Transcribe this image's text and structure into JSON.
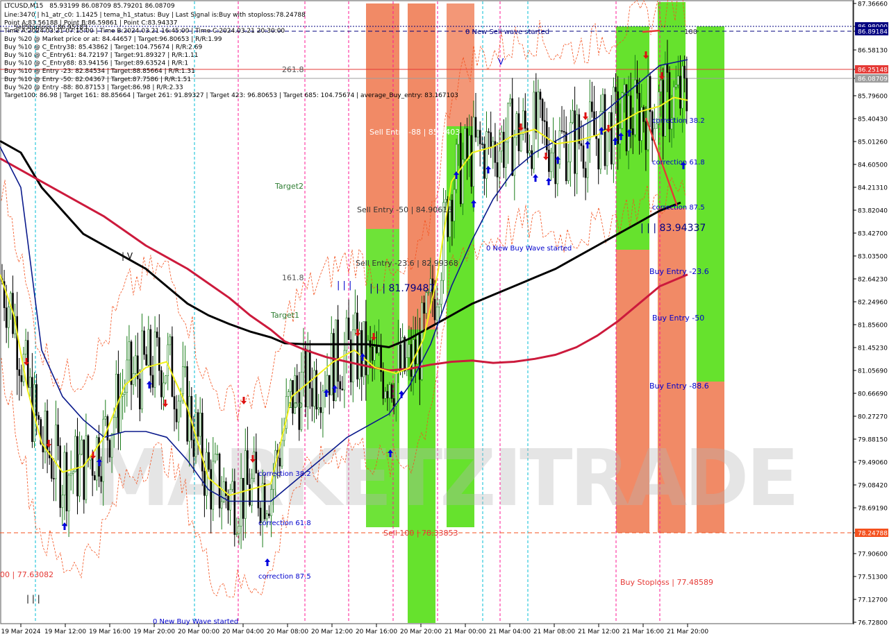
{
  "chart_data": {
    "type": "candlestick",
    "symbol_timeframe": "LTCUSD,M15",
    "header_ohlc": "85.93199 86.08709 85.79201 86.08709",
    "info_lines": [
      "Line:3470 | h1_atr_c0: 1.1425 | tema_h1_status: Buy | Last Signal is:Buy with stoploss:78.24788",
      "Point A:83.56188 | Point B:86.59861 | Point C:83.94337",
      "Time A:2024.03.21 07:15:00 | Time B:2024.03.21 16:45:00 | Time C:2024.03.21 20:30:00",
      "Buy %20 @ Market price or at: 84.44657 | Target:96.80653 | R/R:1.99",
      "Buy %10 @ C_Entry38: 85.43862 | Target:104.75674 | R/R:2.69",
      "Buy %10 @ C_Entry61: 84.72197 | Target:91.89327 | R/R:1.11",
      "Buy %10 @ C_Entry88: 83.94156 | Target:89.63524 | R/R:1",
      "Buy %10 @ Entry -23: 82.84534 | Target:88.85664 | R/R:1.31",
      "Buy %10 @ Entry -50: 82.04367 | Target:87.7586 | R/R:1.51",
      "Buy %20 @ Entry -88: 80.87153 | Target:86.98 | R/R:2.33",
      "Target100: 86.98 | Target 161: 88.85664 | Target 261: 91.89327 | Target 423: 96.80653 | Target 685: 104.75674 | average_Buy_entry: 83.167103"
    ],
    "y_ticks": [
      "87.36660",
      "86.98000",
      "86.89184",
      "86.58130",
      "86.25148",
      "86.08709",
      "85.79600",
      "85.40430",
      "85.01260",
      "84.60500",
      "84.21310",
      "83.82040",
      "83.42700",
      "83.03500",
      "82.64230",
      "82.24960",
      "81.85600",
      "81.45230",
      "81.05690",
      "80.66690",
      "80.27270",
      "79.88150",
      "79.49060",
      "79.08420",
      "78.69190",
      "78.24788",
      "77.90600",
      "77.51300",
      "77.12700",
      "76.72800"
    ],
    "x_ticks": [
      "19 Mar 2024",
      "19 Mar 12:00",
      "19 Mar 16:00",
      "19 Mar 20:00",
      "20 Mar 00:00",
      "20 Mar 04:00",
      "20 Mar 08:00",
      "20 Mar 12:00",
      "20 Mar 16:00",
      "20 Mar 20:00",
      "21 Mar 00:00",
      "21 Mar 04:00",
      "21 Mar 08:00",
      "21 Mar 12:00",
      "21 Mar 16:00",
      "21 Mar 20:00"
    ],
    "ylim": [
      76.728,
      87.3666
    ],
    "price_lines": [
      {
        "value": 86.98,
        "label": "86.98000",
        "color": "#000080"
      },
      {
        "value": 86.89184,
        "label": "86.89184",
        "color": "#000080"
      },
      {
        "value": 86.25148,
        "label": "86.25148",
        "color": "#e53935"
      },
      {
        "value": 86.08709,
        "label": "86.08709",
        "color": "#9e9e9e"
      },
      {
        "value": 78.24788,
        "label": "78.24788",
        "color": "#f4511e"
      }
    ],
    "annotations": [
      {
        "text": "0 New Sell wave started",
        "color": "#000080"
      },
      {
        "text": "100",
        "color": "#333333"
      },
      {
        "text": "261.8",
        "color": "#555555"
      },
      {
        "text": "Target2",
        "color": "#2e7d32"
      },
      {
        "text": "161.8",
        "color": "#555555"
      },
      {
        "text": "Target1",
        "color": "#2e7d32"
      },
      {
        "text": "100",
        "color": "#2e7d32"
      },
      {
        "text": "Sell Entry -88 | 85.2403",
        "color": "#ffffff"
      },
      {
        "text": "Sell Entry -50 | 84.90615",
        "color": "#333333"
      },
      {
        "text": "Sell Entry -23.6 | 82.99368",
        "color": "#333333"
      },
      {
        "text": "| | | 81.79487",
        "color": "#000080"
      },
      {
        "text": "| | |",
        "color": "#0000cc"
      },
      {
        "text": "0 New Buy Wave started",
        "color": "#0000cc"
      },
      {
        "text": "correction 38.2",
        "color": "#0000cc"
      },
      {
        "text": "correction 61.8",
        "color": "#0000cc"
      },
      {
        "text": "correction 87.5",
        "color": "#0000cc"
      },
      {
        "text": "| | | 83.94337",
        "color": "#000080"
      },
      {
        "text": "Buy Entry -23.6",
        "color": "#0000cc"
      },
      {
        "text": "Buy Entry -50",
        "color": "#0000cc"
      },
      {
        "text": "Buy Entry -88.6",
        "color": "#0000cc"
      },
      {
        "text": "correction 38.2",
        "color": "#0000cc"
      },
      {
        "text": "correction 61.8",
        "color": "#0000cc"
      },
      {
        "text": "correction 87.5",
        "color": "#0000cc"
      },
      {
        "text": "Sell 100 | 78.33853",
        "color": "#e53935"
      },
      {
        "text": "Buy Stoploss | 77.48589",
        "color": "#e53935"
      },
      {
        "text": "0 New Buy Wave started",
        "color": "#0000cc"
      },
      {
        "text": "00 | 77.63082",
        "color": "#e53935"
      },
      {
        "text": "| | |",
        "color": "#000000"
      },
      {
        "text": "| V",
        "color": "#000000"
      },
      {
        "text": "V",
        "color": "#0000cc"
      },
      {
        "text": "SellStoploss | 86.95183",
        "color": "#000000"
      }
    ],
    "watermark": "MARKETZITRADE",
    "colors": {
      "background": "#ffffff",
      "plot_bg": "#ffffff",
      "green_zone": "#5ee022",
      "red_zone": "#f07d55",
      "ma_black": "#000000",
      "ma_red": "#cc1a3c",
      "ma_blue": "#0a1a8c",
      "ma_yellow": "#f2f21a",
      "band_orange": "#f4511e",
      "bull_candle": "#1a7d1a",
      "bear_candle": "#000000"
    },
    "series": [
      {
        "name": "black_ma",
        "x": [
          0,
          30,
          60,
          90,
          120,
          150,
          180,
          210,
          240,
          270,
          300,
          330,
          360,
          390,
          410,
          440,
          470,
          500,
          530,
          560,
          590,
          620,
          650,
          680,
          710,
          740,
          770,
          800,
          830,
          860,
          890,
          920,
          950,
          980
        ],
        "values": [
          85.0,
          84.8,
          84.2,
          83.8,
          83.4,
          83.2,
          83.0,
          82.8,
          82.5,
          82.2,
          82.0,
          81.85,
          81.72,
          81.62,
          81.52,
          81.5,
          81.5,
          81.5,
          81.5,
          81.45,
          81.6,
          81.8,
          82.0,
          82.2,
          82.35,
          82.5,
          82.65,
          82.8,
          83.0,
          83.2,
          83.4,
          83.6,
          83.8,
          83.94
        ]
      },
      {
        "name": "red_ma",
        "x": [
          0,
          30,
          60,
          90,
          120,
          150,
          180,
          210,
          240,
          270,
          300,
          330,
          360,
          390,
          410,
          440,
          470,
          500,
          530,
          560,
          590,
          620,
          650,
          680,
          710,
          740,
          770,
          800,
          830,
          860,
          890,
          920,
          950,
          990
        ],
        "values": [
          84.7,
          84.5,
          84.3,
          84.1,
          83.9,
          83.7,
          83.45,
          83.2,
          83.0,
          82.8,
          82.55,
          82.3,
          82.0,
          81.75,
          81.55,
          81.4,
          81.28,
          81.2,
          81.12,
          81.05,
          81.08,
          81.15,
          81.2,
          81.22,
          81.18,
          81.2,
          81.25,
          81.32,
          81.45,
          81.65,
          81.9,
          82.2,
          82.5,
          82.7
        ]
      },
      {
        "name": "blue_ma",
        "x": [
          0,
          30,
          60,
          90,
          120,
          150,
          180,
          210,
          240,
          270,
          300,
          330,
          360,
          390,
          410,
          440,
          470,
          500,
          530,
          560,
          590,
          620,
          650,
          680,
          710,
          740,
          770,
          800,
          830,
          860,
          890,
          920,
          950,
          990
        ],
        "values": [
          84.9,
          84.2,
          81.4,
          80.6,
          80.2,
          79.9,
          80.0,
          80.0,
          79.9,
          79.5,
          79.0,
          78.8,
          78.8,
          78.8,
          79.0,
          79.3,
          79.6,
          79.9,
          80.1,
          80.3,
          80.8,
          81.5,
          82.5,
          83.3,
          84.0,
          84.5,
          84.8,
          85.0,
          85.2,
          85.4,
          85.7,
          86.0,
          86.3,
          86.4
        ]
      },
      {
        "name": "yellow_ma",
        "x": [
          0,
          20,
          40,
          60,
          90,
          120,
          150,
          180,
          210,
          240,
          270,
          300,
          330,
          360,
          390,
          420,
          450,
          480,
          510,
          540,
          570,
          590,
          610,
          630,
          650,
          680,
          710,
          740,
          770,
          800,
          830,
          860,
          890,
          920,
          950,
          970,
          990
        ],
        "values": [
          82.7,
          82.0,
          80.7,
          79.8,
          79.3,
          79.4,
          79.9,
          80.8,
          81.1,
          81.2,
          80.4,
          79.2,
          78.9,
          79.0,
          79.1,
          80.6,
          80.9,
          81.2,
          81.4,
          81.1,
          81.0,
          81.1,
          81.6,
          82.7,
          84.3,
          84.8,
          84.9,
          85.1,
          85.2,
          84.95,
          85.0,
          85.1,
          85.3,
          85.5,
          85.6,
          85.75,
          85.7
        ]
      }
    ]
  }
}
